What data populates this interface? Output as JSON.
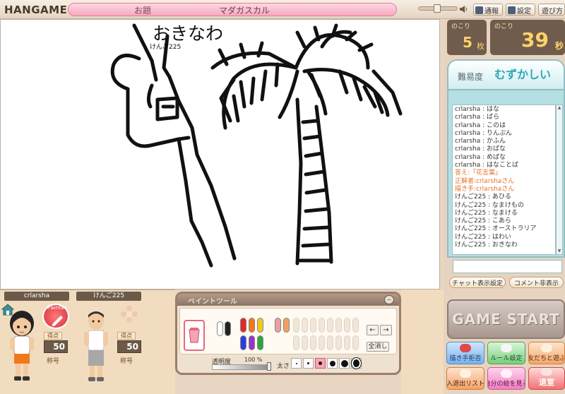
{
  "header": {
    "logo": "HANGAME",
    "topic_label": "お題",
    "topic_value": "マダガスカル",
    "buttons": [
      {
        "name": "tsuho",
        "label": "通報"
      },
      {
        "name": "settei",
        "label": "設定"
      },
      {
        "name": "asobikata",
        "label": "遊び方"
      }
    ]
  },
  "canvas": {
    "answer_text": "おきなわ",
    "drawer_name": "けんご225"
  },
  "counters": {
    "remaining_label": "のこり",
    "remaining_cards_value": "5",
    "remaining_cards_unit": "枚",
    "remaining_time_value": "39",
    "remaining_time_unit": "秒"
  },
  "difficulty": {
    "label": "難易度",
    "value": "むずかしい"
  },
  "chat": {
    "messages": [
      {
        "text": "crlarsha : はな",
        "type": "normal"
      },
      {
        "text": "crlarsha : ばら",
        "type": "normal"
      },
      {
        "text": "crlarsha : このは",
        "type": "normal"
      },
      {
        "text": "crlarsha : りんぷん",
        "type": "normal"
      },
      {
        "text": "crlarsha : かふん",
        "type": "normal"
      },
      {
        "text": "crlarsha : おばな",
        "type": "normal"
      },
      {
        "text": "crlarsha : めばな",
        "type": "normal"
      },
      {
        "text": "crlarsha : はなことば",
        "type": "normal"
      },
      {
        "text": "答え:「花言葉」",
        "type": "system"
      },
      {
        "text": "正解者:crlarshaさん",
        "type": "system"
      },
      {
        "text": "描き手:crlarshaさん",
        "type": "system"
      },
      {
        "text": "けんご225 : あひる",
        "type": "normal"
      },
      {
        "text": "けんご225 : なまけもの",
        "type": "normal"
      },
      {
        "text": "けんご225 : なまける",
        "type": "normal"
      },
      {
        "text": "けんご225 : こあら",
        "type": "normal"
      },
      {
        "text": "けんご225 : オーストラリア",
        "type": "normal"
      },
      {
        "text": "けんご225 : はわい",
        "type": "normal"
      },
      {
        "text": "けんご225 : おきなわ",
        "type": "normal"
      }
    ],
    "display_settings_label": "チャット表示設定",
    "hide_comments_label": "コメント非表示"
  },
  "game_start_label": "GAME START",
  "game_buttons": {
    "refuse_drawer": "描き手拒否",
    "rule_settings": "ルール設定",
    "invite_friends": "友だちと遊ぶ",
    "entry_exit_list": "入退出リスト",
    "view_my_drawings": "自分の絵を見る",
    "leave_room": "退室"
  },
  "players": [
    {
      "name": "crlarsha",
      "badge": "Painter",
      "score_label": "得点",
      "score": "50",
      "title_label": "称号"
    },
    {
      "name": "けんご225",
      "score_label": "得点",
      "score": "50",
      "title_label": "称号"
    }
  ],
  "paint_tool": {
    "title": "ペイントツール",
    "clear_all_label": "全消し",
    "opacity_label": "透明度",
    "opacity_value": "100 %",
    "opacity_percent": 100,
    "thickness_label": "太さ",
    "colors": [
      "#ffffff",
      "#222222",
      "#e02a2a",
      "#f07a1a",
      "#f2c81a",
      "#2b3fd8",
      "#9a33c8",
      "#2aa83a",
      "#e8a0a0",
      "#f0a060"
    ]
  }
}
